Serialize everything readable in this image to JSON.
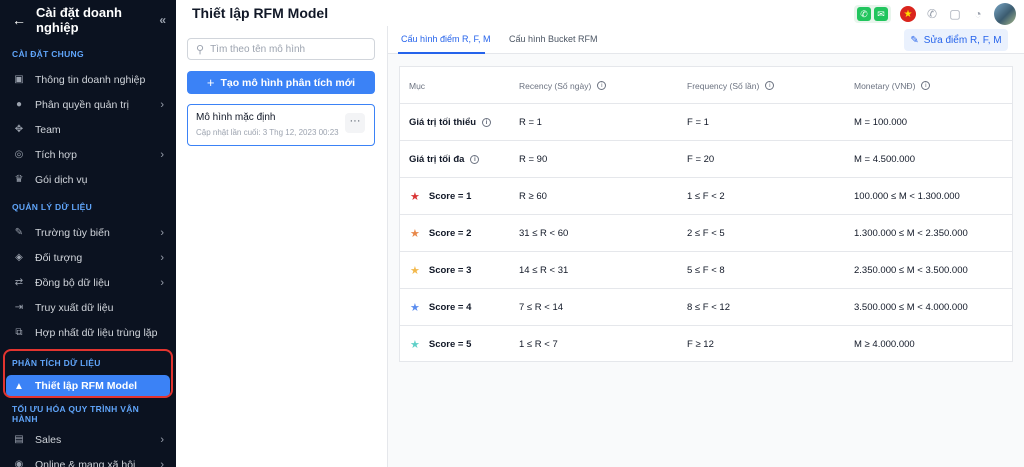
{
  "sidebar": {
    "title": "Cài đặt doanh nghiệp",
    "sections": [
      {
        "label": "CÀI ĐẶT CHUNG",
        "items": [
          {
            "label": "Thông tin doanh nghiệp",
            "icon": "building-icon"
          },
          {
            "label": "Phân quyền quản trị",
            "icon": "user-shield-icon",
            "chevron": true
          },
          {
            "label": "Team",
            "icon": "team-icon"
          },
          {
            "label": "Tích hợp",
            "icon": "integration-icon",
            "chevron": true
          },
          {
            "label": "Gói dịch vụ",
            "icon": "crown-icon"
          }
        ]
      },
      {
        "label": "QUẢN LÝ DỮ LIỆU",
        "items": [
          {
            "label": "Trường tùy biến",
            "icon": "custom-field-icon",
            "chevron": true
          },
          {
            "label": "Đối tượng",
            "icon": "box-icon",
            "chevron": true
          },
          {
            "label": "Đồng bộ dữ liệu",
            "icon": "sync-icon",
            "chevron": true
          },
          {
            "label": "Truy xuất dữ liệu",
            "icon": "export-icon"
          },
          {
            "label": "Hợp nhất dữ liệu trùng lặp",
            "icon": "merge-icon"
          }
        ]
      },
      {
        "label": "PHÂN TÍCH DỮ LIỆU",
        "items": [
          {
            "label": "Thiết lập RFM Model",
            "icon": "rfm-icon",
            "active": true
          }
        ]
      },
      {
        "label": "TỐI ƯU HÓA QUY TRÌNH VẬN HÀNH",
        "items": [
          {
            "label": "Sales",
            "icon": "sales-icon",
            "chevron": true
          },
          {
            "label": "Online & mạng xã hội",
            "icon": "social-icon",
            "chevron": true
          }
        ]
      }
    ]
  },
  "header": {
    "title": "Thiết lập RFM Model"
  },
  "models": {
    "search_placeholder": "Tìm theo tên mô hình",
    "create_label": "Tạo mô hình phân tích mới",
    "card": {
      "name": "Mô hình mặc định",
      "meta": "Cập nhật lần cuối: 3 Thg 12, 2023 00:23",
      "more": "···"
    }
  },
  "main": {
    "tabs": [
      {
        "label": "Cấu hình điểm R, F, M",
        "active": true
      },
      {
        "label": "Cấu hình Bucket RFM",
        "active": false
      }
    ],
    "edit_label": "Sửa điểm R, F, M",
    "table": {
      "headers": [
        "Mục",
        "Recency (Số ngày)",
        "Frequency (Số lần)",
        "Monetary (VNĐ)"
      ],
      "rows": [
        {
          "label": "Giá trị tối thiểu",
          "info": true,
          "r": "R = 1",
          "f": "F = 1",
          "m": "M = 100.000"
        },
        {
          "label": "Giá trị tối đa",
          "info": true,
          "r": "R = 90",
          "f": "F = 20",
          "m": "M = 4.500.000"
        },
        {
          "label": "Score = 1",
          "star_color": "#d93434",
          "r": "R ≥ 60",
          "f": "1 ≤ F < 2",
          "m": "100.000 ≤ M < 1.300.000"
        },
        {
          "label": "Score = 2",
          "star_color": "#e8884a",
          "r": "31 ≤ R < 60",
          "f": "2 ≤ F < 5",
          "m": "1.300.000 ≤ M < 2.350.000"
        },
        {
          "label": "Score = 3",
          "star_color": "#f2b84b",
          "r": "14 ≤ R < 31",
          "f": "5 ≤ F < 8",
          "m": "2.350.000 ≤ M < 3.500.000"
        },
        {
          "label": "Score = 4",
          "star_color": "#5b8def",
          "r": "7 ≤ R < 14",
          "f": "8 ≤ F < 12",
          "m": "3.500.000 ≤ M < 4.000.000"
        },
        {
          "label": "Score = 5",
          "star_color": "#5fd0c8",
          "r": "1 ≤ R < 7",
          "f": "F ≥ 12",
          "m": "M ≥ 4.000.000"
        }
      ]
    }
  },
  "colors": {
    "accent": "#3b82f6",
    "sidebar_bg": "#0b1220",
    "highlight": "#e3342f"
  }
}
